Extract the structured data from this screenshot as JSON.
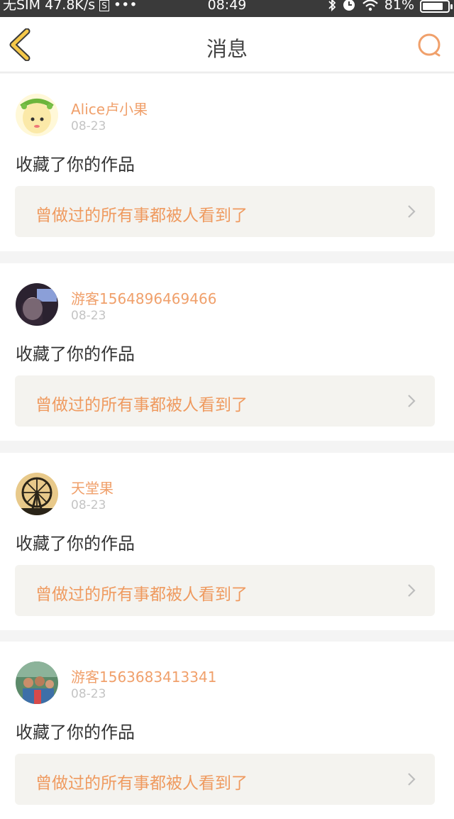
{
  "status_bar": {
    "carrier": "无SIM",
    "speed": "47.8K/s",
    "dots": "•••",
    "time": "08:49",
    "battery": "81%",
    "battery_level": 0.81
  },
  "header": {
    "title": "消息"
  },
  "notifications": [
    {
      "username": "Alice卢小果",
      "date": "08-23",
      "action": "收藏了你的作品",
      "work_title": "曾做过的所有事都被人看到了"
    },
    {
      "username": "游客1564896469466",
      "date": "08-23",
      "action": "收藏了你的作品",
      "work_title": "曾做过的所有事都被人看到了"
    },
    {
      "username": "天堂果",
      "date": "08-23",
      "action": "收藏了你的作品",
      "work_title": "曾做过的所有事都被人看到了"
    },
    {
      "username": "游客1563683413341",
      "date": "08-23",
      "action": "收藏了你的作品",
      "work_title": "曾做过的所有事都被人看到了"
    }
  ],
  "colors": {
    "accent": "#f0a06b",
    "back_arrow": "#f5c84a"
  }
}
